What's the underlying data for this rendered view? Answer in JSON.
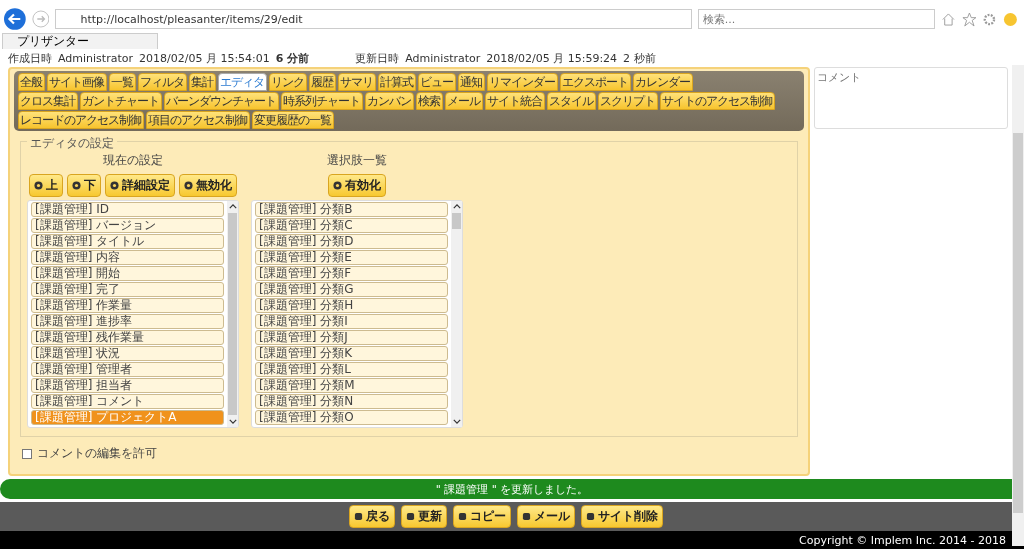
{
  "browser": {
    "url": "http://localhost/pleasanter/items/29/edit",
    "search_placeholder": "検索...",
    "tab_title": "プリザンター"
  },
  "header": [
    "作成日時",
    "Administrator",
    "2018/02/05 月 15:54:01",
    "6 分前",
    "更新日時",
    "Administrator",
    "2018/02/05 月 15:59:24",
    "2 秒前"
  ],
  "tabs": [
    {
      "label": "全般",
      "selected": false
    },
    {
      "label": "サイト画像",
      "selected": false
    },
    {
      "label": "一覧",
      "selected": false
    },
    {
      "label": "フィルタ",
      "selected": false
    },
    {
      "label": "集計",
      "selected": false
    },
    {
      "label": "エディタ",
      "selected": true
    },
    {
      "label": "リンク",
      "selected": false
    },
    {
      "label": "履歴",
      "selected": false
    },
    {
      "label": "サマリ",
      "selected": false
    },
    {
      "label": "計算式",
      "selected": false
    },
    {
      "label": "ビュー",
      "selected": false
    },
    {
      "label": "通知",
      "selected": false
    },
    {
      "label": "リマインダー",
      "selected": false
    },
    {
      "label": "エクスポート",
      "selected": false
    },
    {
      "label": "カレンダー",
      "selected": false
    },
    {
      "label": "クロス集計",
      "selected": false
    },
    {
      "label": "ガントチャート",
      "selected": false
    },
    {
      "label": "バーンダウンチャート",
      "selected": false
    },
    {
      "label": "時系列チャート",
      "selected": false
    },
    {
      "label": "カンバン",
      "selected": false
    },
    {
      "label": "検索",
      "selected": false
    },
    {
      "label": "メール",
      "selected": false
    },
    {
      "label": "サイト統合",
      "selected": false
    },
    {
      "label": "スタイル",
      "selected": false
    },
    {
      "label": "スクリプト",
      "selected": false
    },
    {
      "label": "サイトのアクセス制御",
      "selected": false
    },
    {
      "label": "レコードのアクセス制御",
      "selected": false
    },
    {
      "label": "項目のアクセス制御",
      "selected": false
    },
    {
      "label": "変更履歴の一覧",
      "selected": false
    }
  ],
  "editor": {
    "legend": "エディタの設定",
    "current": {
      "title": "現在の設定",
      "buttons": [
        "上",
        "下",
        "詳細設定",
        "無効化"
      ],
      "items": [
        {
          "label": "[課題管理] ID",
          "selected": false
        },
        {
          "label": "[課題管理] バージョン",
          "selected": false
        },
        {
          "label": "[課題管理] タイトル",
          "selected": false
        },
        {
          "label": "[課題管理] 内容",
          "selected": false
        },
        {
          "label": "[課題管理] 開始",
          "selected": false
        },
        {
          "label": "[課題管理] 完了",
          "selected": false
        },
        {
          "label": "[課題管理] 作業量",
          "selected": false
        },
        {
          "label": "[課題管理] 進捗率",
          "selected": false
        },
        {
          "label": "[課題管理] 残作業量",
          "selected": false
        },
        {
          "label": "[課題管理] 状況",
          "selected": false
        },
        {
          "label": "[課題管理] 管理者",
          "selected": false
        },
        {
          "label": "[課題管理] 担当者",
          "selected": false
        },
        {
          "label": "[課題管理] コメント",
          "selected": false
        },
        {
          "label": "[課題管理] プロジェクトA",
          "selected": true
        }
      ]
    },
    "options": {
      "title": "選択肢一覧",
      "buttons": [
        "有効化"
      ],
      "items": [
        {
          "label": "[課題管理] 分類B",
          "selected": false
        },
        {
          "label": "[課題管理] 分類C",
          "selected": false
        },
        {
          "label": "[課題管理] 分類D",
          "selected": false
        },
        {
          "label": "[課題管理] 分類E",
          "selected": false
        },
        {
          "label": "[課題管理] 分類F",
          "selected": false
        },
        {
          "label": "[課題管理] 分類G",
          "selected": false
        },
        {
          "label": "[課題管理] 分類H",
          "selected": false
        },
        {
          "label": "[課題管理] 分類I",
          "selected": false
        },
        {
          "label": "[課題管理] 分類J",
          "selected": false
        },
        {
          "label": "[課題管理] 分類K",
          "selected": false
        },
        {
          "label": "[課題管理] 分類L",
          "selected": false
        },
        {
          "label": "[課題管理] 分類M",
          "selected": false
        },
        {
          "label": "[課題管理] 分類N",
          "selected": false
        },
        {
          "label": "[課題管理] 分類O",
          "selected": false
        }
      ]
    }
  },
  "allow_comment_edit": {
    "label": "コメントの編集を許可",
    "checked": false
  },
  "comment": {
    "placeholder": "コメント"
  },
  "message": "\" 課題管理 \" を更新しました。",
  "footer_buttons": [
    "戻る",
    "更新",
    "コピー",
    "メール",
    "サイト削除"
  ],
  "copyright": "Copyright © Implem Inc. 2014 - 2018"
}
